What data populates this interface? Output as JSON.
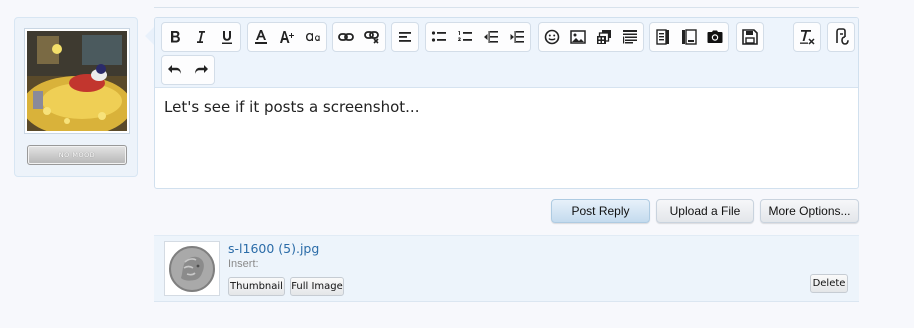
{
  "user_panel": {
    "mood_label": "NO MOOD"
  },
  "toolbar": {
    "row1_groups": [
      [
        "bold-icon",
        "italic-icon",
        "underline-icon"
      ],
      [
        "text-color-icon",
        "font-size-icon",
        "font-family-icon"
      ],
      [
        "link-icon",
        "unlink-icon"
      ],
      [
        "align-left-icon"
      ],
      [
        "bullet-list-icon",
        "numbered-list-icon",
        "outdent-icon",
        "indent-icon"
      ],
      [
        "smilie-icon",
        "image-icon",
        "media-icon",
        "quote-icon"
      ],
      [
        "spoiler-icon",
        "toggle-bbcode-icon",
        "camera-icon"
      ],
      [
        "save-draft-icon"
      ],
      [
        "remove-format-icon"
      ],
      [
        "restore-draft-icon"
      ]
    ],
    "row2_groups": [
      [
        "undo-icon",
        "redo-icon"
      ]
    ]
  },
  "editor": {
    "text": "Let's see if it posts a screenshot..."
  },
  "actions": {
    "post_reply": "Post Reply",
    "upload_file": "Upload a File",
    "more_options": "More Options..."
  },
  "attachment": {
    "filename": "s-l1600 (5).jpg",
    "insert_label": "Insert:",
    "thumbnail_button": "Thumbnail",
    "full_image_button": "Full Image",
    "delete_button": "Delete"
  }
}
